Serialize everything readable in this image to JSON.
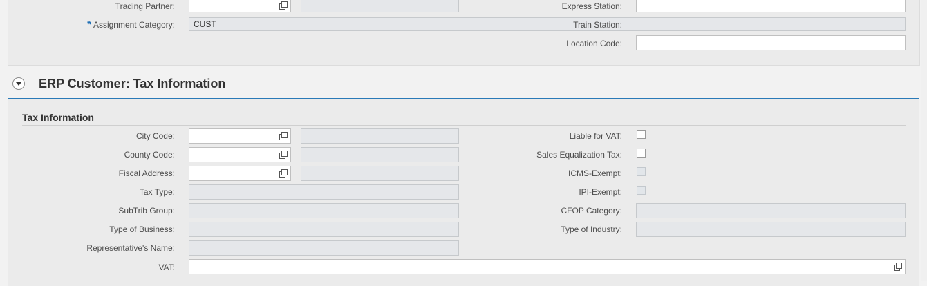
{
  "top_section": {
    "trading_partner": {
      "label": "Trading Partner:",
      "value": "",
      "description": ""
    },
    "assignment_category": {
      "label": "Assignment Category:",
      "required_mark": "*",
      "value": "CUST"
    },
    "express_station": {
      "label": "Express Station:",
      "value": ""
    },
    "train_station": {
      "label": "Train Station:",
      "value": ""
    },
    "location_code": {
      "label": "Location Code:",
      "value": ""
    }
  },
  "tax_section": {
    "title": "ERP Customer: Tax Information",
    "group_title": "Tax Information",
    "left_fields": {
      "city_code": {
        "label": "City Code:",
        "value": "",
        "description": ""
      },
      "county_code": {
        "label": "County Code:",
        "value": "",
        "description": ""
      },
      "fiscal_address": {
        "label": "Fiscal Address:",
        "value": "",
        "description": ""
      },
      "tax_type": {
        "label": "Tax Type:",
        "value": ""
      },
      "subtrib_group": {
        "label": "SubTrib Group:",
        "value": ""
      },
      "type_of_business": {
        "label": "Type of Business:",
        "value": ""
      },
      "representatives_name": {
        "label": "Representative's Name:",
        "value": ""
      },
      "vat": {
        "label": "VAT:",
        "value": ""
      }
    },
    "right_fields": {
      "liable_for_vat": {
        "label": "Liable for VAT:",
        "checked": false,
        "enabled": true
      },
      "sales_equalization_tax": {
        "label": "Sales Equalization Tax:",
        "checked": false,
        "enabled": true
      },
      "icms_exempt": {
        "label": "ICMS-Exempt:",
        "checked": false,
        "enabled": false
      },
      "ipi_exempt": {
        "label": "IPI-Exempt:",
        "checked": false,
        "enabled": false
      },
      "cfop_category": {
        "label": "CFOP Category:",
        "value": ""
      },
      "type_of_industry": {
        "label": "Type of Industry:",
        "value": ""
      }
    }
  },
  "icons": {
    "value_help": "value-help-icon",
    "expander": "collapse-section-icon"
  },
  "colors": {
    "accent": "#2a7ab8",
    "required": "#1f6fb5",
    "readonly_bg": "#e5e7ea"
  }
}
